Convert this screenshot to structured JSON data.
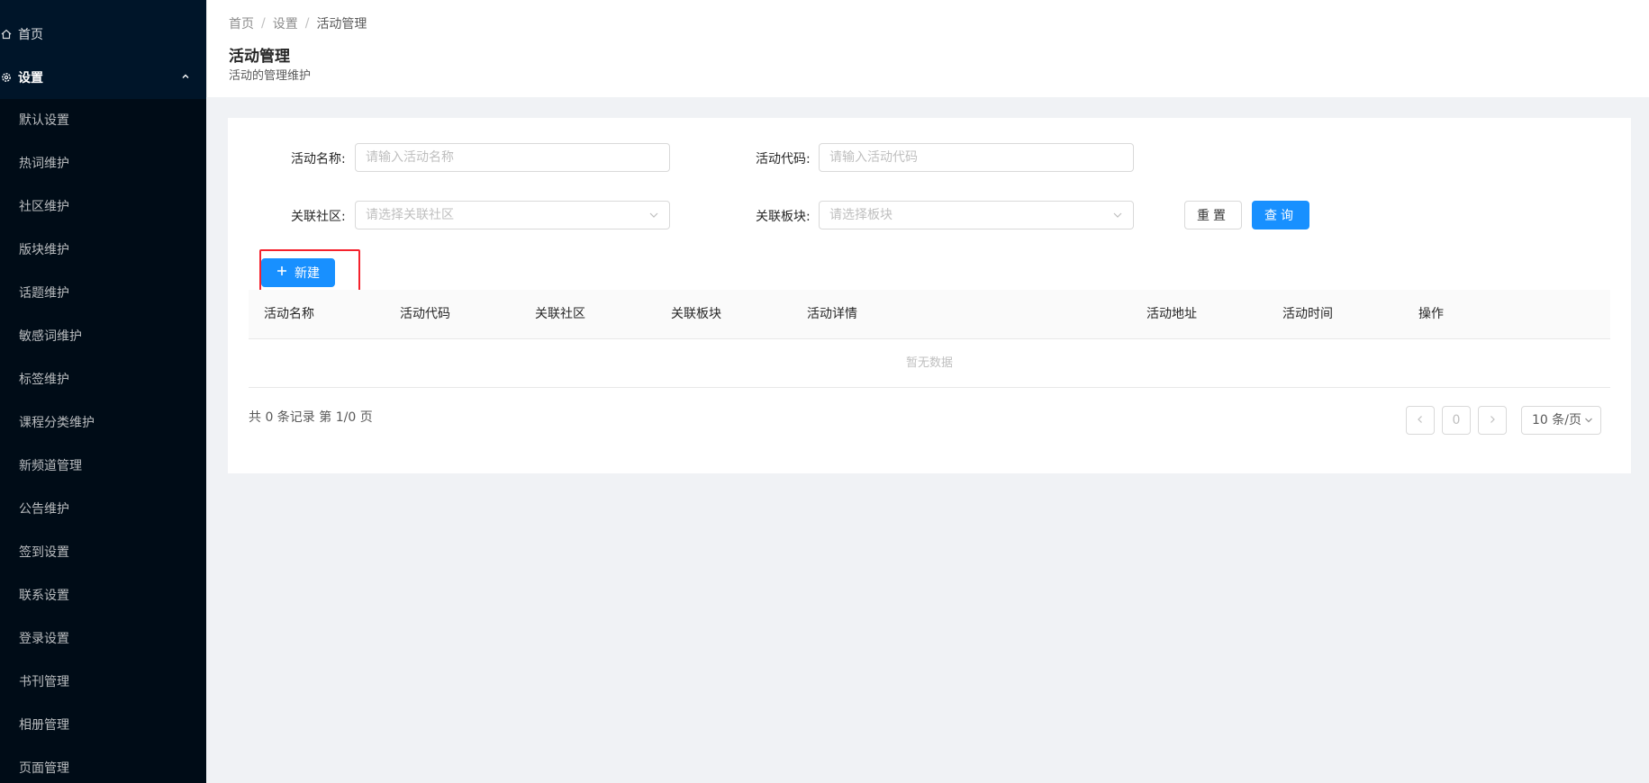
{
  "sidebar": {
    "home_label": "首页",
    "group_label": "设置",
    "items": [
      {
        "label": "默认设置"
      },
      {
        "label": "热词维护"
      },
      {
        "label": "社区维护"
      },
      {
        "label": "版块维护"
      },
      {
        "label": "话题维护"
      },
      {
        "label": "敏感词维护"
      },
      {
        "label": "标签维护"
      },
      {
        "label": "课程分类维护"
      },
      {
        "label": "新频道管理"
      },
      {
        "label": "公告维护"
      },
      {
        "label": "签到设置"
      },
      {
        "label": "联系设置"
      },
      {
        "label": "登录设置"
      },
      {
        "label": "书刊管理"
      },
      {
        "label": "相册管理"
      },
      {
        "label": "页面管理"
      }
    ]
  },
  "breadcrumb": {
    "home": "首页",
    "settings": "设置",
    "current": "活动管理",
    "separator": "/"
  },
  "header": {
    "title": "活动管理",
    "subtitle": "活动的管理维护"
  },
  "form": {
    "name_label": "活动名称:",
    "name_placeholder": "请输入活动名称",
    "code_label": "活动代码:",
    "code_placeholder": "请输入活动代码",
    "community_label": "关联社区:",
    "community_placeholder": "请选择关联社区",
    "block_label": "关联板块:",
    "block_placeholder": "请选择板块",
    "reset_label": "重置",
    "query_label": "查询"
  },
  "toolbar": {
    "new_label": "新建"
  },
  "table": {
    "columns": [
      "活动名称",
      "活动代码",
      "关联社区",
      "关联板块",
      "活动详情",
      "活动地址",
      "活动时间",
      "操作"
    ],
    "empty_text": "暂无数据"
  },
  "pagination": {
    "summary": "共 0 条记录 第 1/0 页",
    "current_page": "0",
    "page_size": "10 条/页"
  },
  "colors": {
    "sidebar_bg": "#001529",
    "primary": "#1890ff",
    "highlight": "#f5222d"
  }
}
